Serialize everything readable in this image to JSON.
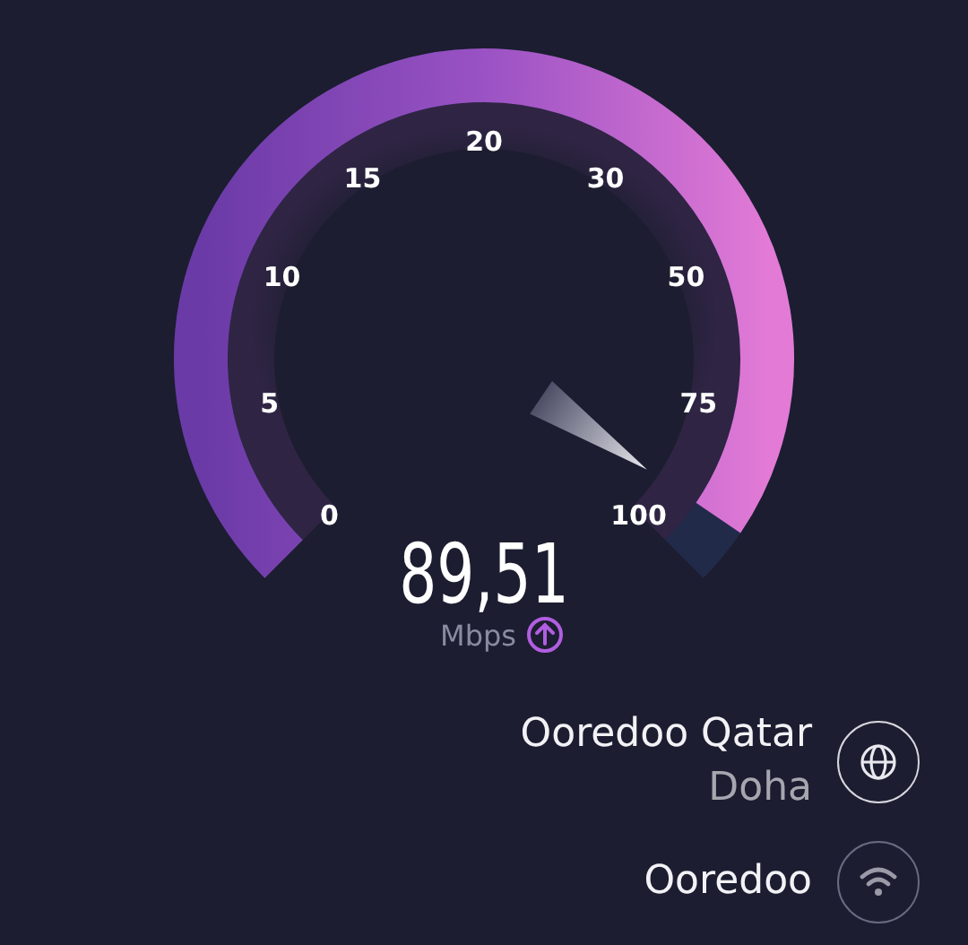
{
  "gauge": {
    "ticks": [
      "0",
      "5",
      "10",
      "15",
      "20",
      "30",
      "50",
      "75",
      "100"
    ]
  },
  "reading": {
    "value": "89,51",
    "unit": "Mbps"
  },
  "server": {
    "provider": "Ooredoo Qatar",
    "location": "Doha"
  },
  "network": {
    "name": "Ooredoo"
  }
}
